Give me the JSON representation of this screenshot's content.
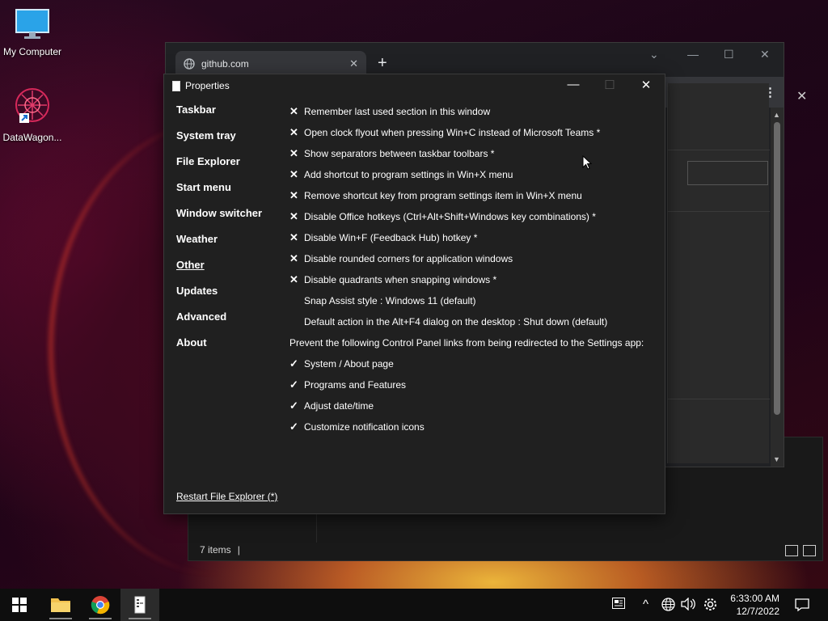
{
  "desktop": {
    "icons": [
      {
        "label": "My Computer"
      },
      {
        "label": "DataWagon..."
      }
    ]
  },
  "browser": {
    "tab_title": "github.com",
    "newtab_symbol": "+"
  },
  "explorer": {
    "status_text": "7 items"
  },
  "dialog": {
    "title": "Properties",
    "nav": [
      {
        "label": "Taskbar"
      },
      {
        "label": "System tray"
      },
      {
        "label": "File Explorer"
      },
      {
        "label": "Start menu"
      },
      {
        "label": "Window switcher"
      },
      {
        "label": "Weather"
      },
      {
        "label": "Other"
      },
      {
        "label": "Updates"
      },
      {
        "label": "Advanced"
      },
      {
        "label": "About"
      }
    ],
    "active_nav": "Other",
    "options": [
      {
        "mark": "✕",
        "text": "Remember last used section in this window"
      },
      {
        "mark": "✕",
        "text": "Open clock flyout when pressing Win+C instead of Microsoft Teams *"
      },
      {
        "mark": "✕",
        "text": "Show separators between taskbar toolbars *"
      },
      {
        "mark": "✕",
        "text": "Add shortcut to program settings in Win+X menu"
      },
      {
        "mark": "✕",
        "text": "Remove shortcut key from program settings item in Win+X menu"
      },
      {
        "mark": "✕",
        "text": "Disable Office hotkeys (Ctrl+Alt+Shift+Windows key combinations) *"
      },
      {
        "mark": "✕",
        "text": "Disable Win+F (Feedback Hub) hotkey *"
      },
      {
        "mark": "✕",
        "text": "Disable rounded corners for application windows"
      },
      {
        "mark": "✕",
        "text": "Disable quadrants when snapping windows *"
      },
      {
        "mark": "",
        "text": "Snap Assist style : Windows 11 (default)"
      },
      {
        "mark": "",
        "text": "Default action in the Alt+F4 dialog on the desktop : Shut down (default)"
      }
    ],
    "section_heading": "Prevent the following Control Panel links from being redirected to the Settings app:",
    "links": [
      {
        "mark": "✓",
        "text": "System / About page"
      },
      {
        "mark": "✓",
        "text": "Programs and Features"
      },
      {
        "mark": "✓",
        "text": "Adjust date/time"
      },
      {
        "mark": "✓",
        "text": "Customize notification icons"
      }
    ],
    "restart_link": "Restart File Explorer (*)"
  },
  "taskbar": {
    "time": "6:33:00 AM",
    "date": "12/7/2022"
  },
  "colors": {
    "dialog_bg": "#202020",
    "taskbar_bg": "#0e0e0e",
    "explorer_folder": "#f2c14e",
    "windows_logo": "#ffffff"
  }
}
